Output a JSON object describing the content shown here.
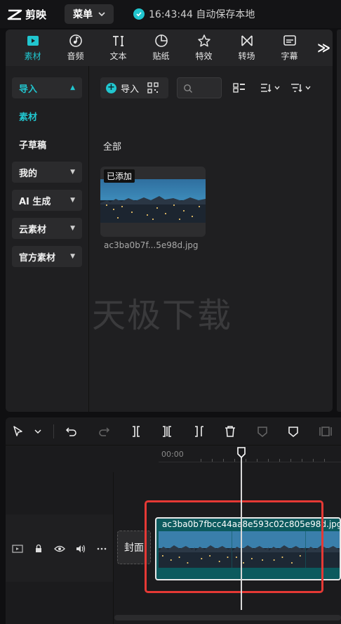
{
  "titlebar": {
    "app_name": "剪映",
    "menu_label": "菜单",
    "save_status": "16:43:44 自动保存本地"
  },
  "toolbar": {
    "tabs": [
      {
        "label": "素材",
        "icon": "media-icon",
        "active": true
      },
      {
        "label": "音频",
        "icon": "music-note-icon"
      },
      {
        "label": "文本",
        "icon": "text-icon"
      },
      {
        "label": "贴纸",
        "icon": "sticker-icon"
      },
      {
        "label": "特效",
        "icon": "effects-star-icon"
      },
      {
        "label": "转场",
        "icon": "transition-icon"
      },
      {
        "label": "字幕",
        "icon": "subtitle-icon"
      }
    ],
    "more": "≫"
  },
  "sidebar": {
    "items": [
      {
        "label": "导入",
        "style": "active-boxed"
      },
      {
        "label": "素材",
        "style": "teal"
      },
      {
        "label": "子草稿",
        "style": "plain"
      },
      {
        "label": "我的",
        "style": "boxed"
      },
      {
        "label": "AI 生成",
        "style": "boxed"
      },
      {
        "label": "云素材",
        "style": "boxed"
      },
      {
        "label": "官方素材",
        "style": "boxed"
      }
    ]
  },
  "content": {
    "import_label": "导入",
    "section_label": "全部",
    "media": {
      "tag": "已添加",
      "filename": "ac3ba0b7f...5e98d.jpg"
    },
    "watermark": "天极下载"
  },
  "timeline": {
    "ruler_start": "00:00",
    "cover_label": "封面",
    "clip_name": "ac3ba0b7fbcc44aa8e593c02c805e98d.jpg"
  },
  "colors": {
    "accent": "#21c6cf",
    "highlight_box": "#e53935",
    "clip_bg": "#0c5a5e"
  }
}
